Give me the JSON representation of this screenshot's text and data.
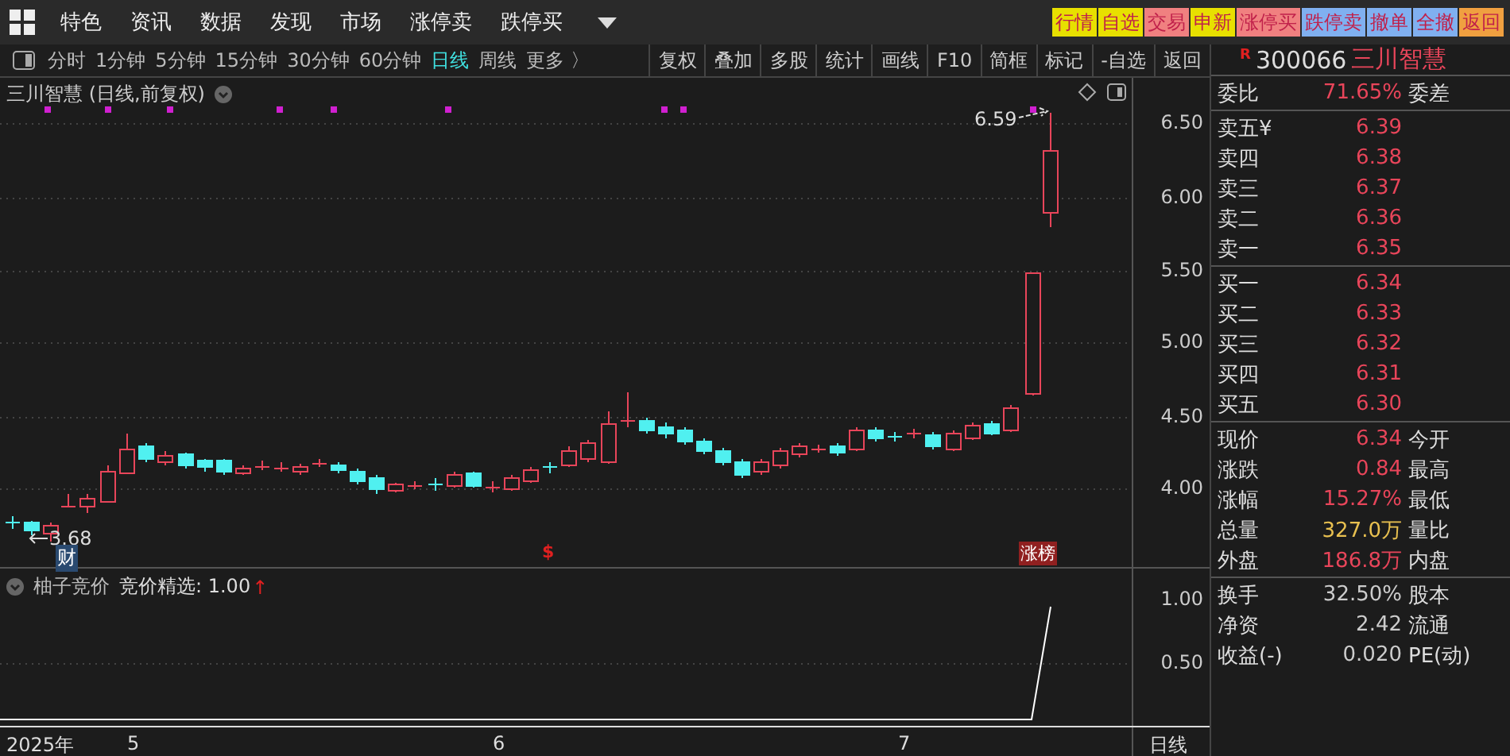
{
  "menu": {
    "items": [
      "特色",
      "资讯",
      "数据",
      "发现",
      "市场",
      "涨停卖",
      "跌停买"
    ]
  },
  "trade_buttons": [
    {
      "label": "行情",
      "color": "#e8e000"
    },
    {
      "label": "自选",
      "color": "#e8e000"
    },
    {
      "label": "交易",
      "color": "#f08080"
    },
    {
      "label": "申新",
      "color": "#e8e000"
    },
    {
      "label": "涨停买",
      "color": "#f08080"
    },
    {
      "label": "跌停卖",
      "color": "#80b0f0"
    },
    {
      "label": "撤单",
      "color": "#80b0f0"
    },
    {
      "label": "全撤",
      "color": "#80b0f0"
    },
    {
      "label": "返回",
      "color": "#f0a040"
    }
  ],
  "periods": [
    {
      "label": "分时",
      "selected": false
    },
    {
      "label": "1分钟",
      "selected": false
    },
    {
      "label": "5分钟",
      "selected": false
    },
    {
      "label": "15分钟",
      "selected": false
    },
    {
      "label": "30分钟",
      "selected": false
    },
    {
      "label": "60分钟",
      "selected": false
    },
    {
      "label": "日线",
      "selected": true
    },
    {
      "label": "周线",
      "selected": false
    },
    {
      "label": "更多 〉",
      "selected": false
    }
  ],
  "tools": [
    "复权",
    "叠加",
    "多股",
    "统计",
    "画线",
    "F10",
    "简框",
    "标记",
    "-自选",
    "返回"
  ],
  "chart": {
    "title": "三川智慧 (日线,前复权)",
    "y_ticks": [
      "6.50",
      "6.00",
      "5.50",
      "5.00",
      "4.50",
      "4.00"
    ],
    "high_label": "6.59",
    "low_label": "3.68",
    "finance_badge": "财",
    "signal_mark": "$",
    "rank_badge": "涨榜"
  },
  "indicator": {
    "name": "柚子竞价",
    "reading": "竞价精选: 1.00",
    "arrow": "↑",
    "y_ticks": [
      "1.00",
      "0.50"
    ]
  },
  "time_axis": {
    "labels": [
      "2025年",
      "5",
      "6",
      "7"
    ],
    "period": "日线"
  },
  "quote": {
    "badge": "R",
    "code": "300066",
    "name": "三川智慧",
    "ratio": {
      "label": "委比",
      "value": "71.65%",
      "label2": "委差"
    },
    "asks": [
      {
        "label": "卖五",
        "mark": "¥",
        "price": "6.39"
      },
      {
        "label": "卖四",
        "price": "6.38"
      },
      {
        "label": "卖三",
        "price": "6.37"
      },
      {
        "label": "卖二",
        "price": "6.36"
      },
      {
        "label": "卖一",
        "price": "6.35"
      }
    ],
    "bids": [
      {
        "label": "买一",
        "price": "6.34"
      },
      {
        "label": "买二",
        "price": "6.33"
      },
      {
        "label": "买三",
        "price": "6.32"
      },
      {
        "label": "买四",
        "price": "6.31"
      },
      {
        "label": "买五",
        "price": "6.30"
      }
    ],
    "stats": [
      {
        "label": "现价",
        "value": "6.34",
        "label2": "今开",
        "color": "#e8455a"
      },
      {
        "label": "涨跌",
        "value": "0.84",
        "label2": "最高",
        "color": "#e8455a"
      },
      {
        "label": "涨幅",
        "value": "15.27%",
        "label2": "最低",
        "color": "#e8455a"
      },
      {
        "label": "总量",
        "value": "327.0万",
        "label2": "量比",
        "color": "#e8c050"
      },
      {
        "label": "外盘",
        "value": "186.8万",
        "label2": "内盘",
        "color": "#e8455a"
      }
    ],
    "fundamentals": [
      {
        "label": "换手",
        "value": "32.50%",
        "label2": "股本"
      },
      {
        "label": "净资",
        "value": "2.42",
        "label2": "流通"
      },
      {
        "label": "收益(-)",
        "value": "0.020",
        "label2": "PE(动)"
      }
    ]
  }
}
